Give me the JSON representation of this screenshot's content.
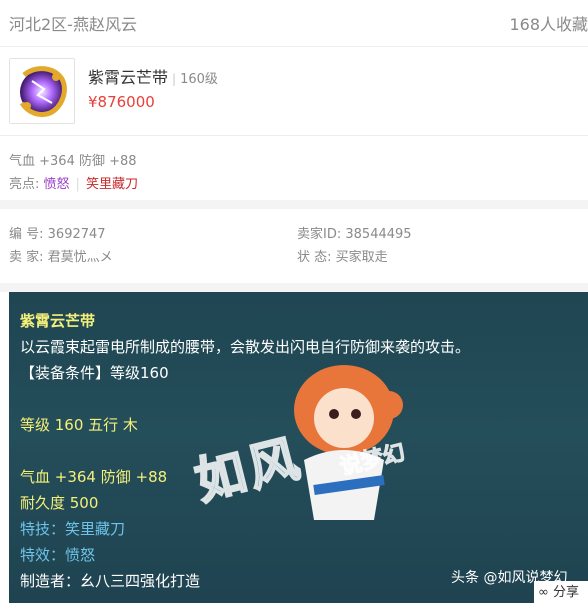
{
  "header": {
    "server": "河北2区-燕赵风云",
    "favorites": "168人收藏"
  },
  "item": {
    "icon": "belt-item-icon",
    "name": "紫霄云芒带",
    "level": "160级",
    "price": "¥876000"
  },
  "attributes": {
    "line": "气血 +364 防御 +88",
    "highlights_label": "亮点:",
    "tags": [
      "愤怒",
      "笑里藏刀"
    ]
  },
  "meta": {
    "id_label": "编 号:",
    "id_value": "3692747",
    "seller_id_label": "卖家ID:",
    "seller_id_value": "38544495",
    "seller_label": "卖 家:",
    "seller_value": "君莫忧灬メ",
    "status_label": "状 态:",
    "status_value": "买家取走"
  },
  "detail": {
    "title": "紫霄云芒带",
    "desc": "以云霞束起雷电所制成的腰带，会散发出闪电自行防御来袭的攻击。",
    "requirement": "【装备条件】等级160",
    "level_element": "等级 160 五行 木",
    "stats": "气血 +364 防御 +88",
    "durability": "耐久度 500",
    "skill": "特技：笑里藏刀",
    "effect": "特效：愤怒",
    "maker": "制造者：幺八三四强化打造"
  },
  "overlay": {
    "watermark_main": "如风",
    "watermark_sub": "说梦幻",
    "toutiao": "头条 @如风说梦幻",
    "share": "分享"
  }
}
